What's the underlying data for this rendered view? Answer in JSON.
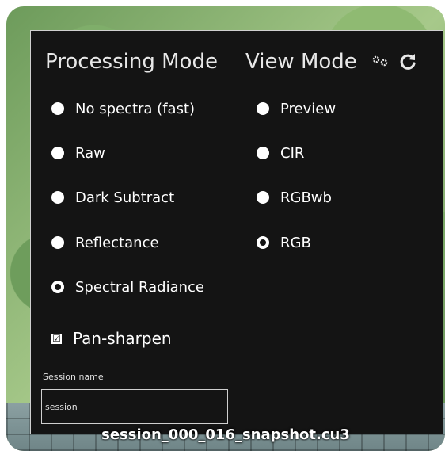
{
  "processing_mode": {
    "title": "Processing Mode",
    "options": [
      {
        "label": "No spectra (fast)",
        "selected": false
      },
      {
        "label": "Raw",
        "selected": false
      },
      {
        "label": "Dark Subtract",
        "selected": false
      },
      {
        "label": "Reflectance",
        "selected": false
      },
      {
        "label": "Spectral Radiance",
        "selected": true
      }
    ]
  },
  "view_mode": {
    "title": "View Mode",
    "options": [
      {
        "label": "Preview",
        "selected": false
      },
      {
        "label": "CIR",
        "selected": false
      },
      {
        "label": "RGBwb",
        "selected": false
      },
      {
        "label": "RGB",
        "selected": true
      }
    ]
  },
  "pan_sharpen": {
    "label": "Pan-sharpen",
    "checked": true,
    "mark": "☑"
  },
  "session": {
    "label": "Session name",
    "value": "session"
  },
  "filename": "session_000_016_snapshot.cu3",
  "icons": {
    "settings": "gears-icon",
    "refresh": "refresh-icon"
  },
  "colors": {
    "panel_bg": "#141414",
    "text": "#ffffff",
    "border": "#cfcfcf"
  }
}
